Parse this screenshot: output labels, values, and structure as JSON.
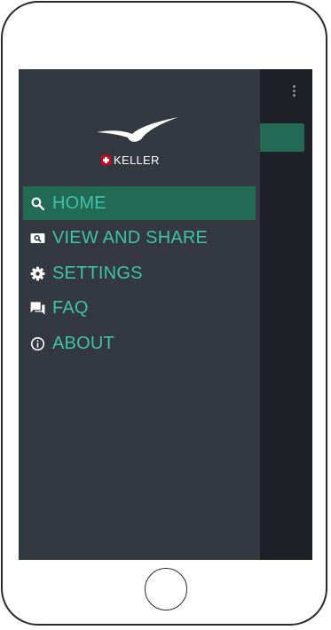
{
  "app": {
    "brand_text": "KELLER",
    "colors": {
      "drawer_bg": "#343841",
      "accent": "#3fc4a5",
      "active_bg": "#236a55",
      "screen_bg": "#1d2026"
    }
  },
  "background": {
    "overflow_menu_icon": "more-vertical-icon"
  },
  "drawer": {
    "logo_icon": "seagull-icon",
    "swiss_flag_icon": "swiss-cross-icon",
    "items": [
      {
        "label": "HOME",
        "icon": "search-icon",
        "active": true
      },
      {
        "label": "VIEW AND SHARE",
        "icon": "image-search-icon",
        "active": false
      },
      {
        "label": "SETTINGS",
        "icon": "gear-icon",
        "active": false
      },
      {
        "label": "FAQ",
        "icon": "chat-bubbles-icon",
        "active": false
      },
      {
        "label": "ABOUT",
        "icon": "info-icon",
        "active": false
      }
    ]
  }
}
